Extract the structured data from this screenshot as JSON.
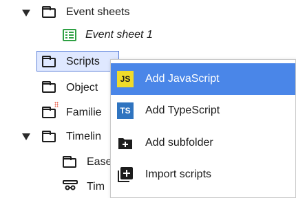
{
  "tree": {
    "event_sheets": "Event sheets",
    "event_sheet_1": "Event sheet 1",
    "scripts": "Scripts",
    "object_types": "Object",
    "families": "Familie",
    "timelines": "Timelin",
    "ease": "Ease",
    "tim": "Tim"
  },
  "menu": {
    "items": [
      {
        "label": "Add JavaScript",
        "icon": "js-icon"
      },
      {
        "label": "Add TypeScript",
        "icon": "ts-icon"
      },
      {
        "label": "Add subfolder",
        "icon": "add-folder-icon"
      },
      {
        "label": "Import scripts",
        "icon": "import-icon"
      }
    ]
  },
  "icons": {
    "js_text": "JS",
    "ts_text": "TS"
  },
  "colors": {
    "active_item": "#4a86e8",
    "selection": "#dfe8ff",
    "js": "#f0db2a",
    "ts": "#2f74c0"
  }
}
